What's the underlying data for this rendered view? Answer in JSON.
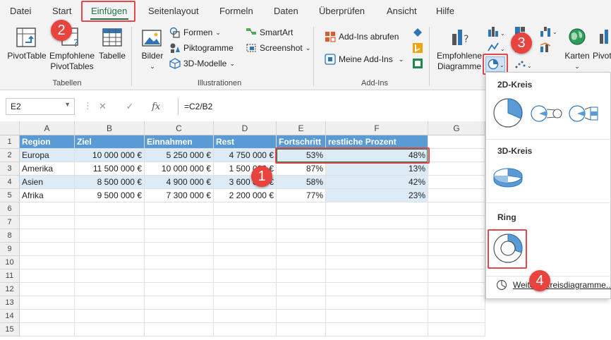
{
  "tabs": [
    "Datei",
    "Start",
    "Einfügen",
    "Seitenlayout",
    "Formeln",
    "Daten",
    "Überprüfen",
    "Ansicht",
    "Hilfe"
  ],
  "ribbon": {
    "pivot_table": "PivotTable",
    "recommended_pivot_line1": "Empfohlene",
    "recommended_pivot_line2": "PivotTables",
    "table": "Tabelle",
    "group_tables": "Tabellen",
    "images": "Bilder",
    "shapes": "Formen",
    "pictograms": "Piktogramme",
    "models3d": "3D-Modelle",
    "smartart": "SmartArt",
    "screenshot": "Screenshot",
    "group_illustrations": "Illustrationen",
    "get_addins": "Add-Ins abrufen",
    "my_addins": "Meine Add-Ins",
    "group_addins": "Add-Ins",
    "recommended_charts_line1": "Empfohlene",
    "recommended_charts_line2": "Diagramme",
    "maps": "Karten",
    "pivot_chart": "Pivot"
  },
  "formula_bar": {
    "name_box": "E2",
    "fx": "fx",
    "formula": "=C2/B2"
  },
  "columns": [
    "A",
    "B",
    "C",
    "D",
    "E",
    "F",
    "G"
  ],
  "rows": [
    "1",
    "2",
    "3",
    "4",
    "5",
    "6",
    "7",
    "8",
    "9",
    "10",
    "11",
    "12",
    "13",
    "14",
    "15"
  ],
  "sheet": {
    "headers": [
      "Region",
      "Ziel",
      "Einnahmen",
      "Rest",
      "Fortschritt",
      "restliche Prozent"
    ],
    "data": [
      [
        "Europa",
        "10 000 000 €",
        "5 250 000 €",
        "4 750 000 €",
        "53%",
        "48%"
      ],
      [
        "Amerika",
        "11 500 000 €",
        "10 000 000 €",
        "1 500 000 €",
        "87%",
        "13%"
      ],
      [
        "Asien",
        "8 500 000 €",
        "4 900 000 €",
        "3 600 000 €",
        "58%",
        "42%"
      ],
      [
        "Afrika",
        "9 500 000 €",
        "7 300 000 €",
        "2 200 000 €",
        "77%",
        "23%"
      ]
    ]
  },
  "dropdown": {
    "section_2d": "2D-Kreis",
    "section_3d": "3D-Kreis",
    "section_ring": "Ring",
    "more_link": "Weitere Kreisdiagramme..."
  },
  "badges": [
    "1",
    "2",
    "3",
    "4"
  ],
  "colors": {
    "accent": "#217346",
    "header_fill": "#5b9bd5",
    "band_fill": "#ddebf7",
    "highlight": "#e0484d",
    "badge": "#e8433f"
  }
}
